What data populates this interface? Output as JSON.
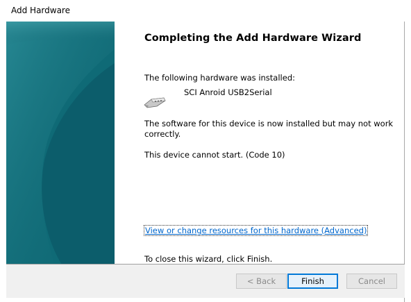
{
  "window": {
    "title": "Add Hardware"
  },
  "wizard": {
    "heading": "Completing the Add Hardware Wizard",
    "installed_label": "The following hardware was installed:",
    "device_name": "SCI Anroid USB2Serial",
    "device_icon": "serial-cable-icon",
    "warning_line1": "The software for this device is now installed but may not work",
    "warning_line2": "correctly.",
    "error_text": "This device cannot start. (Code 10)",
    "resources_link": "View or change resources for this hardware (Advanced)",
    "close_instruction": "To close this wizard, click Finish."
  },
  "buttons": {
    "back": "< Back",
    "finish": "Finish",
    "cancel": "Cancel"
  },
  "background_window": {
    "partial_text": "...... ..... ...... (..........)"
  },
  "colors": {
    "side_panel": "#0e6472",
    "link": "#0066cc",
    "default_button_border": "#0078d7",
    "footer": "#f0f0f0"
  }
}
